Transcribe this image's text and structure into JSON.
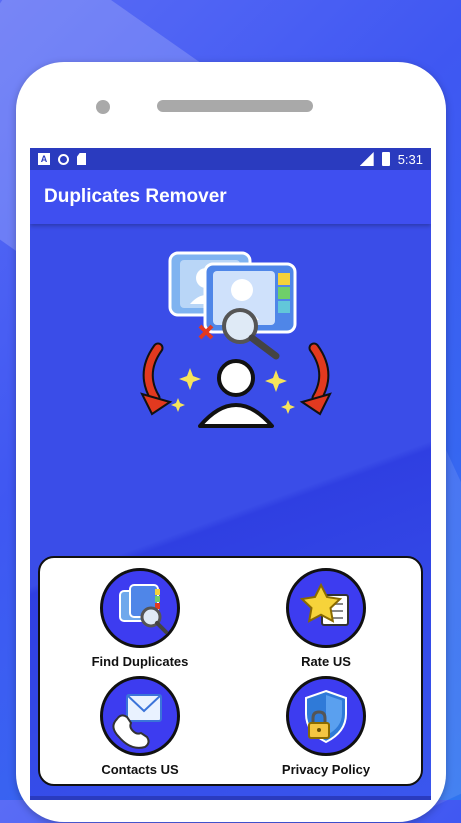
{
  "statusbar": {
    "time": "5:31",
    "a_icon_letter": "A"
  },
  "appbar": {
    "title": "Duplicates Remover"
  },
  "menu": [
    {
      "label": "Find Duplicates",
      "icon": "contacts-magnifier-icon"
    },
    {
      "label": "Rate US",
      "icon": "star-rating-icon"
    },
    {
      "label": "Contacts US",
      "icon": "envelope-phone-icon"
    },
    {
      "label": "Privacy Policy",
      "icon": "shield-lock-icon"
    }
  ],
  "colors": {
    "appbar": "#3f4ff0",
    "statusbar": "#2a3bbf",
    "circle": "#3d3cf0",
    "arrow": "#e2391f"
  }
}
